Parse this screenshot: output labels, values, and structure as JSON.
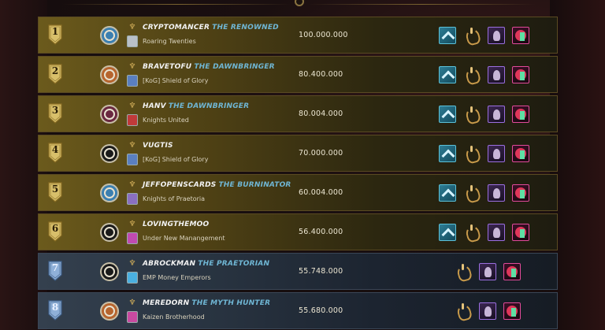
{
  "leaderboard": [
    {
      "rank": "1",
      "tier": "gold",
      "name": "CRYPTOMANCER",
      "epithet": "THE RENOWNED",
      "guild": "Roaring Twenties",
      "score": "100.000.000",
      "league_color": "#3b7fb0",
      "guild_color": "#b9c0c8",
      "cards": [
        "chevron",
        "gold",
        "purple",
        "pink"
      ]
    },
    {
      "rank": "2",
      "tier": "gold",
      "name": "BRAVETOFU",
      "epithet": "THE DAWNBRINGER",
      "guild": "[KoG] Shield of Glory",
      "score": "80.400.000",
      "league_color": "#b6642e",
      "guild_color": "#5a7fc0",
      "cards": [
        "chevron",
        "gold",
        "purple",
        "pink"
      ]
    },
    {
      "rank": "3",
      "tier": "gold",
      "name": "HANV",
      "epithet": "THE DAWNBRINGER",
      "guild": "Knights United",
      "score": "80.004.000",
      "league_color": "#6a2840",
      "guild_color": "#c03a3a",
      "cards": [
        "chevron",
        "gold",
        "purple",
        "pink"
      ]
    },
    {
      "rank": "4",
      "tier": "gold",
      "name": "VUGTIS",
      "epithet": "",
      "guild": "[KoG] Shield of Glory",
      "score": "70.000.000",
      "league_color": "#1a1a1a",
      "guild_color": "#5a7fc0",
      "cards": [
        "chevron",
        "gold",
        "purple",
        "pink"
      ]
    },
    {
      "rank": "5",
      "tier": "gold",
      "name": "JEFFOPENSCARDS",
      "epithet": "THE BURNINATOR",
      "guild": "Knights of Praetoria",
      "score": "60.004.000",
      "league_color": "#3b7fb0",
      "guild_color": "#8a6fc0",
      "cards": [
        "chevron",
        "gold",
        "purple",
        "pink"
      ]
    },
    {
      "rank": "6",
      "tier": "gold",
      "name": "LOVINGTHEMOO",
      "epithet": "",
      "guild": "Under New Manangement",
      "score": "56.400.000",
      "league_color": "#1a1a1a",
      "guild_color": "#c04ab0",
      "cards": [
        "chevron",
        "gold",
        "purple",
        "pink"
      ]
    },
    {
      "rank": "7",
      "tier": "silver",
      "name": "ABROCKMAN",
      "epithet": "THE PRAETORIAN",
      "guild": "EMP Money Emperors",
      "score": "55.748.000",
      "league_color": "#1a1a1a",
      "guild_color": "#4ab0e0",
      "cards": [
        "gold",
        "purple",
        "pink"
      ]
    },
    {
      "rank": "8",
      "tier": "silver",
      "name": "MEREDORN",
      "epithet": "THE MYTH HUNTER",
      "guild": "Kaizen Brotherhood",
      "score": "55.680.000",
      "league_color": "#b6642e",
      "guild_color": "#c84aa0",
      "cards": [
        "gold",
        "purple",
        "pink"
      ]
    }
  ],
  "icons": {
    "rank_badge": "shield-rank-icon",
    "league": "league-emblem-icon",
    "title": "title-crest-icon",
    "guild": "guild-crest-icon",
    "card_types": {
      "chevron": "rank-up-card-icon",
      "gold": "gold-serpent-card-icon",
      "purple": "hooded-figure-card-icon",
      "pink": "dragon-card-icon"
    }
  }
}
